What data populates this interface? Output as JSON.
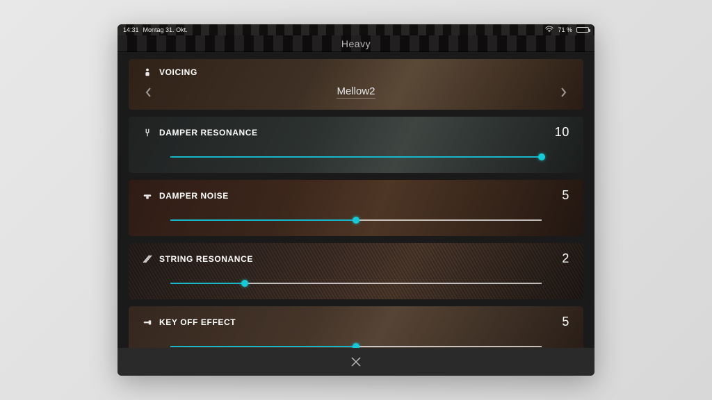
{
  "status": {
    "time": "14:31",
    "date": "Montag 31. Okt.",
    "battery_pct": "71 %"
  },
  "header": {
    "title": "Heavy"
  },
  "voicing": {
    "label": "VOICING",
    "preset": "Mellow2"
  },
  "sliders": [
    {
      "key": "damper_res",
      "label": "DAMPER RESONANCE",
      "value": 10,
      "max": 10,
      "icon": "tuning-fork"
    },
    {
      "key": "damper_noise",
      "label": "DAMPER NOISE",
      "value": 5,
      "max": 10,
      "icon": "damper"
    },
    {
      "key": "string_res",
      "label": "STRING RESONANCE",
      "value": 2,
      "max": 10,
      "icon": "strings"
    },
    {
      "key": "key_off",
      "label": "KEY OFF EFFECT",
      "value": 5,
      "max": 10,
      "icon": "key"
    }
  ],
  "colors": {
    "accent": "#17c9d6",
    "track": "rgba(255,255,255,0.7)"
  }
}
